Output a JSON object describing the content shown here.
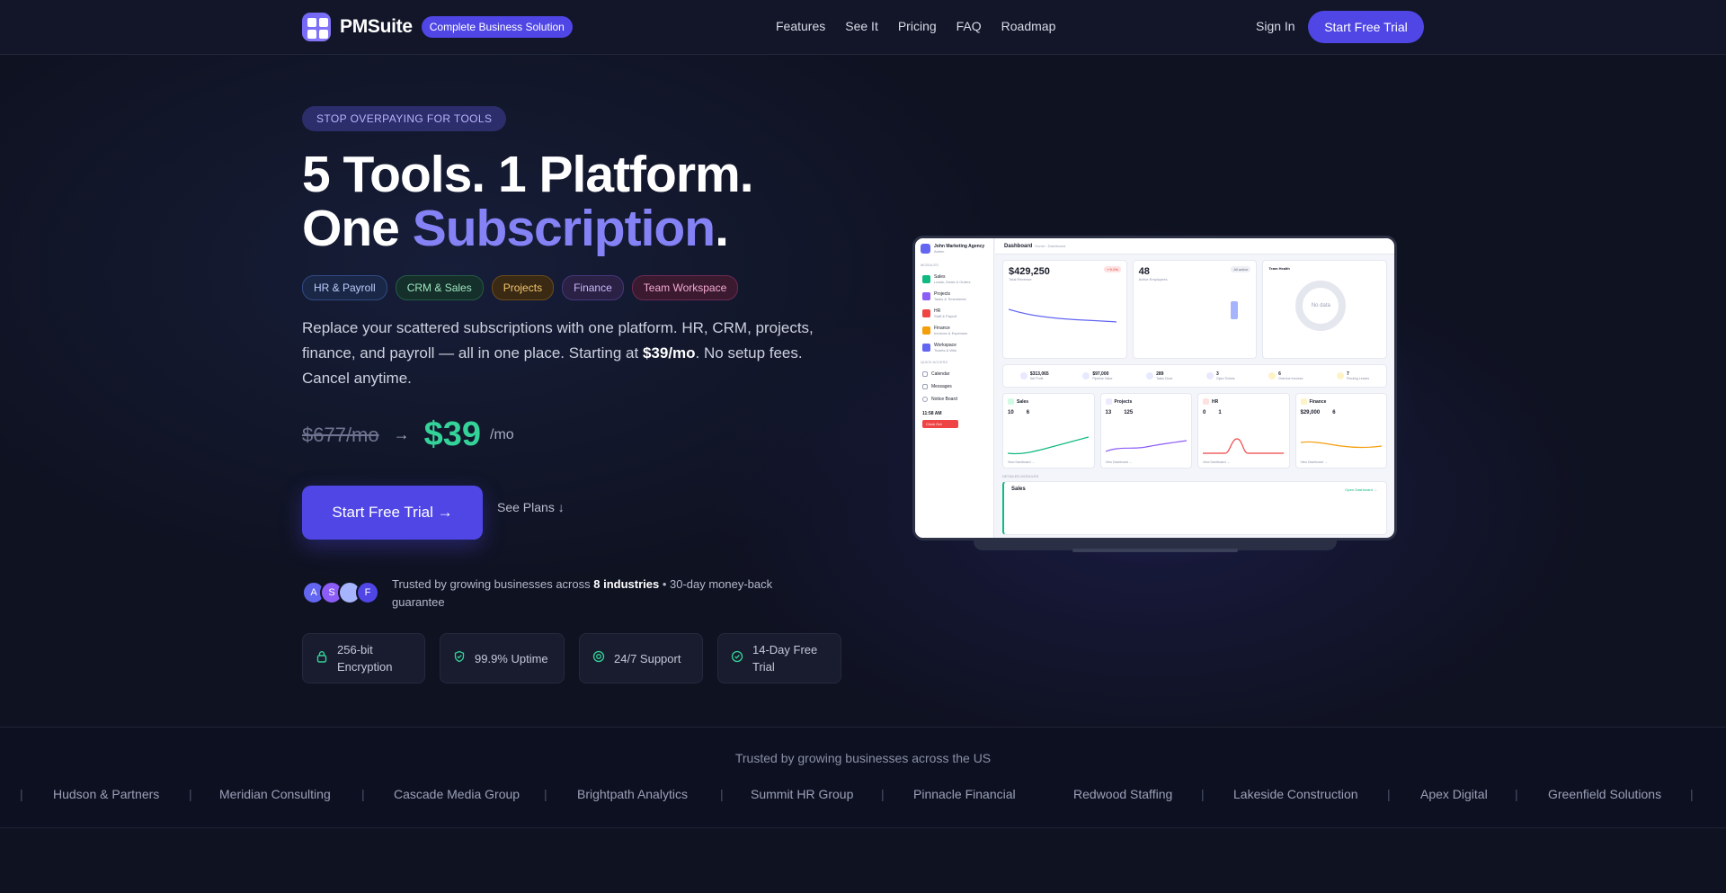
{
  "nav": {
    "brand": "PMSuite",
    "badge": "Complete Business Solution",
    "links": [
      "Features",
      "See It",
      "Pricing",
      "FAQ",
      "Roadmap"
    ],
    "signin": "Sign In",
    "cta": "Start Free Trial"
  },
  "hero": {
    "eyebrow": "STOP OVERPAYING FOR TOOLS",
    "headline_line1": "5 Tools. 1 Platform.",
    "headline_line2_a": "One ",
    "headline_line2_accent": "Subscription",
    "headline_line2_b": ".",
    "tags": [
      "HR & Payroll",
      "CRM & Sales",
      "Projects",
      "Finance",
      "Team Workspace"
    ],
    "desc_a": "Replace your scattered subscriptions with one platform. HR, CRM, projects, finance, and payroll — all in one place. Starting at ",
    "desc_price": "$39/mo",
    "desc_b": ". No setup fees. Cancel anytime.",
    "old_price": "$677/mo",
    "arrow": "→",
    "new_price": "$39",
    "per": "/mo",
    "cta": "Start Free Trial →",
    "see_plans": "See Plans ↓",
    "avatars": [
      "A",
      "S",
      "",
      "F"
    ],
    "trust_a": "Trusted by growing businesses across ",
    "trust_bold": "8 industries",
    "trust_b": " • 30-day money-back guarantee",
    "badges": [
      "256-bit Encryption",
      "99.9% Uptime",
      "24/7 Support",
      "14-Day Free Trial"
    ]
  },
  "dashboard": {
    "org": "John Marketing Agency",
    "org_sub": "Admin",
    "sidebar_section": "MODULES",
    "sidebar_items": [
      {
        "label": "Sales",
        "sub": "Leads, Deals & Orders"
      },
      {
        "label": "Projects",
        "sub": "Tasks & Timesheets"
      },
      {
        "label": "HR",
        "sub": "Staff & Payroll"
      },
      {
        "label": "Finance",
        "sub": "Invoices & Expenses"
      },
      {
        "label": "Workspace",
        "sub": "Tickets & Wiki"
      }
    ],
    "quick_section": "QUICK ACCESS",
    "quick_items": [
      "Calendar",
      "Messages",
      "Notice Board"
    ],
    "clock": "11:58 AM",
    "clock_out": "Clock Out",
    "title": "Dashboard",
    "crumb": "Home › Dashboard",
    "kpis": [
      {
        "value": "$429,250",
        "label": "Total Revenue",
        "chip": "+ 9.1%"
      },
      {
        "value": "48",
        "label": "Active Employees",
        "chip": "All active"
      },
      {
        "value": "",
        "label": "Team Health",
        "chip": ""
      }
    ],
    "donut_text": "No data",
    "stats": [
      {
        "v": "$313,065",
        "l": "Net Profit"
      },
      {
        "v": "$97,000",
        "l": "Pipeline Value"
      },
      {
        "v": "289",
        "l": "Tasks Done"
      },
      {
        "v": "3",
        "l": "Open Tickets"
      },
      {
        "v": "6",
        "l": "Overdue Invoices"
      },
      {
        "v": "7",
        "l": "Pending Leaves"
      }
    ],
    "modules": [
      {
        "name": "Sales",
        "a": "10",
        "b": "6",
        "color": "#10b981",
        "link": "View Dashboard →"
      },
      {
        "name": "Projects",
        "a": "13",
        "b": "125",
        "color": "#8b5cf6",
        "link": "View Dashboard →"
      },
      {
        "name": "HR",
        "a": "0",
        "b": "1",
        "color": "#ef4444",
        "link": "View Dashboard →"
      },
      {
        "name": "Finance",
        "a": "$29,000",
        "b": "6",
        "color": "#f59e0b",
        "link": "View Dashboard →"
      }
    ],
    "detailed_label": "DETAILED MODULES",
    "sales_card": "Sales",
    "sales_open": "Open Dashboard →"
  },
  "strip": {
    "title": "Trusted by growing businesses across the US",
    "companies": [
      "Hudson & Partners",
      "Meridian Consulting",
      "Cascade Media Group",
      "Brightpath Analytics",
      "Summit HR Group",
      "Pinnacle Financial",
      "Redwood Staffing",
      "Lakeside Construction",
      "Apex Digital",
      "Greenfield Solutions"
    ]
  },
  "colors": {
    "accent": "#4f46e5",
    "accent_text": "#8482f5",
    "price_green": "#34d399",
    "background": "#0f1221"
  }
}
